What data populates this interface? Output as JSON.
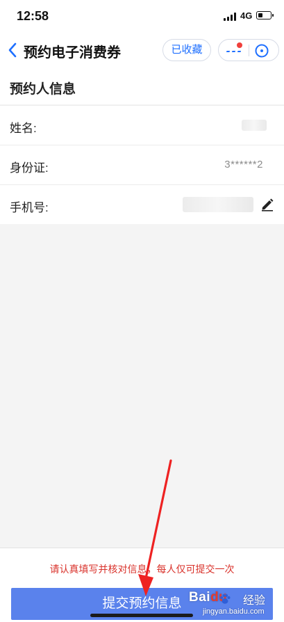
{
  "status_bar": {
    "time": "12:58",
    "network": "4G"
  },
  "nav": {
    "title": "预约电子消费券",
    "favorite_label": "已收藏",
    "accent_color": "#1e6fff",
    "badge_color": "#f0403c"
  },
  "section": {
    "title": "预约人信息"
  },
  "form": {
    "rows": [
      {
        "label": "姓名:",
        "value": ""
      },
      {
        "label": "身份证:",
        "value": "3******2"
      },
      {
        "label": "手机号:",
        "value": ""
      }
    ]
  },
  "footer": {
    "notice": "请认真填写并核对信息，每人仅可提交一次",
    "submit_label": "提交预约信息",
    "notice_color": "#d9322b",
    "button_color": "#5a82ec"
  },
  "watermark": {
    "logo_left": "Bai",
    "logo_right": "du",
    "brand": "经验",
    "url": "jingyan.baidu.com"
  },
  "icons": [
    "signal-icon",
    "battery-icon",
    "back-arrow-icon",
    "more-icon",
    "close-icon",
    "edit-icon",
    "red-arrow-annotation"
  ]
}
